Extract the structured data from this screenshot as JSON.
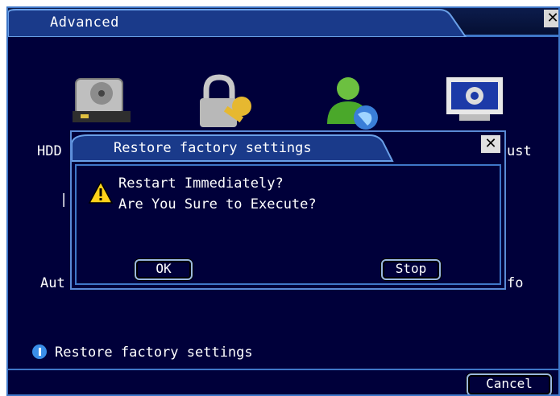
{
  "window": {
    "title": "Advanced",
    "close_glyph": "✕"
  },
  "icons": [
    {
      "name": "hdd-icon",
      "label": "HDD"
    },
    {
      "name": "lock-key-icon",
      "label": ""
    },
    {
      "name": "user-globe-icon",
      "label": ""
    },
    {
      "name": "settings-monitor-icon",
      "label": "ust"
    }
  ],
  "partial_labels": {
    "auto": "Aut",
    "info": "fo",
    "pipe": "|"
  },
  "dialog": {
    "title": "Restore factory settings",
    "close_glyph": "✕",
    "line1": "Restart Immediately?",
    "line2": "Are You Sure to Execute?",
    "ok_label": "OK",
    "stop_label": "Stop"
  },
  "status_text": "Restore factory settings",
  "cancel_label": "Cancel",
  "colors": {
    "background": "#00003a",
    "border": "#3f77c8",
    "info": "#3a8ee8"
  }
}
